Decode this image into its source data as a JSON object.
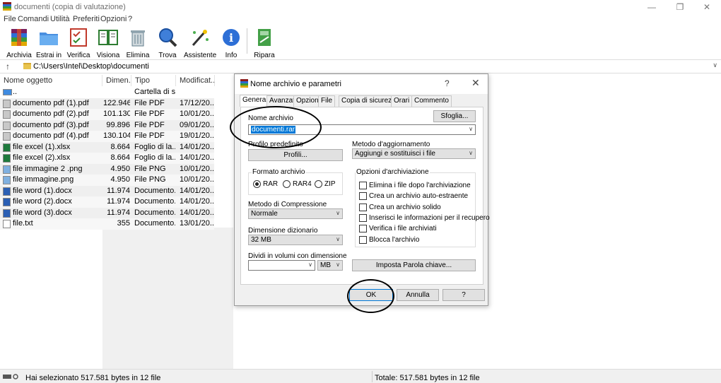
{
  "window": {
    "title": "documenti (copia di valutazione)",
    "minimize": "—",
    "maximize": "❐",
    "close": "✕"
  },
  "menu": [
    "File",
    "Comandi",
    "Utilità",
    "Preferiti",
    "Opzioni",
    "?"
  ],
  "toolbar": [
    {
      "label": "Archivia",
      "icon": "archive-icon"
    },
    {
      "label": "Estrai in",
      "icon": "extract-folder-icon"
    },
    {
      "label": "Verifica",
      "icon": "checklist-icon"
    },
    {
      "label": "Visiona",
      "icon": "book-icon"
    },
    {
      "label": "Elimina",
      "icon": "trash-icon"
    },
    {
      "label": "Trova",
      "icon": "magnifier-icon"
    },
    {
      "label": "Assistente",
      "icon": "wand-icon"
    },
    {
      "label": "Info",
      "icon": "info-icon"
    },
    {
      "label": "Ripara",
      "icon": "repair-kit-icon"
    }
  ],
  "address": {
    "up": "↑",
    "path": "C:\\Users\\Intel\\Desktop\\documenti",
    "dropdown": "∨"
  },
  "columns": {
    "name": "Nome oggetto",
    "size": "Dimen...",
    "type": "Tipo",
    "modified": "Modificat..."
  },
  "files": [
    {
      "name": "..",
      "size": "",
      "type": "Cartella di si...",
      "modified": "",
      "kind": "folder"
    },
    {
      "name": "documento pdf (1).pdf",
      "size": "122.946",
      "type": "File PDF",
      "modified": "17/12/20...",
      "kind": "pdf"
    },
    {
      "name": "documento pdf (2).pdf",
      "size": "101.130",
      "type": "File PDF",
      "modified": "10/01/20...",
      "kind": "pdf"
    },
    {
      "name": "documento pdf (3).pdf",
      "size": "99.896",
      "type": "File PDF",
      "modified": "09/01/20...",
      "kind": "pdf"
    },
    {
      "name": "documento pdf (4).pdf",
      "size": "130.104",
      "type": "File PDF",
      "modified": "19/01/20...",
      "kind": "pdf"
    },
    {
      "name": "file excel (1).xlsx",
      "size": "8.664",
      "type": "Foglio di la...",
      "modified": "14/01/20...",
      "kind": "xlsx"
    },
    {
      "name": "file excel (2).xlsx",
      "size": "8.664",
      "type": "Foglio di la...",
      "modified": "14/01/20...",
      "kind": "xlsx"
    },
    {
      "name": "file immagine 2 .png",
      "size": "4.950",
      "type": "File PNG",
      "modified": "10/01/20...",
      "kind": "png"
    },
    {
      "name": "file immagine.png",
      "size": "4.950",
      "type": "File PNG",
      "modified": "10/01/20...",
      "kind": "png"
    },
    {
      "name": "file word (1).docx",
      "size": "11.974",
      "type": "Documento...",
      "modified": "14/01/20...",
      "kind": "docx"
    },
    {
      "name": "file word (2).docx",
      "size": "11.974",
      "type": "Documento...",
      "modified": "14/01/20...",
      "kind": "docx"
    },
    {
      "name": "file word (3).docx",
      "size": "11.974",
      "type": "Documento...",
      "modified": "14/01/20...",
      "kind": "docx"
    },
    {
      "name": "file.txt",
      "size": "355",
      "type": "Documento...",
      "modified": "13/01/20...",
      "kind": "txt"
    }
  ],
  "status": {
    "left": "Hai selezionato 517.581 bytes in 12 file",
    "right": "Totale: 517.581 bytes in 12 file"
  },
  "dialog": {
    "title": "Nome archivio e parametri",
    "help": "?",
    "close": "✕",
    "tabs": [
      "Generali",
      "Avanzati",
      "Opzioni",
      "File",
      "Copia di sicurezza",
      "Orari",
      "Commento"
    ],
    "archive_name_label": "Nome archivio",
    "archive_name_value": "documenti.rar",
    "browse_button": "Sfoglia...",
    "profile_label": "Profilo predefinito",
    "profile_button": "Profili...",
    "update_method_label": "Metodo d'aggiornamento",
    "update_method_value": "Aggiungi e sostituisci i file",
    "format_label": "Formato archivio",
    "formats": [
      "RAR",
      "RAR4",
      "ZIP"
    ],
    "format_selected": "RAR",
    "options_label": "Opzioni d'archiviazione",
    "options": [
      "Elimina i file dopo l'archiviazione",
      "Crea un archivio auto-estraente",
      "Crea un archivio solido",
      "Inserisci le informazioni per il recupero",
      "Verifica i file archiviati",
      "Blocca l'archivio"
    ],
    "compression_label": "Metodo di Compressione",
    "compression_value": "Normale",
    "dictionary_label": "Dimensione dizionario",
    "dictionary_value": "32 MB",
    "split_label": "Dividi in volumi con dimensione",
    "split_value": "",
    "split_unit": "MB",
    "password_button": "Imposta Parola chiave...",
    "ok_button": "OK",
    "cancel_button": "Annulla",
    "help_button": "?"
  },
  "colors": {
    "selection": "#0078d7",
    "annotation": "#000000"
  }
}
